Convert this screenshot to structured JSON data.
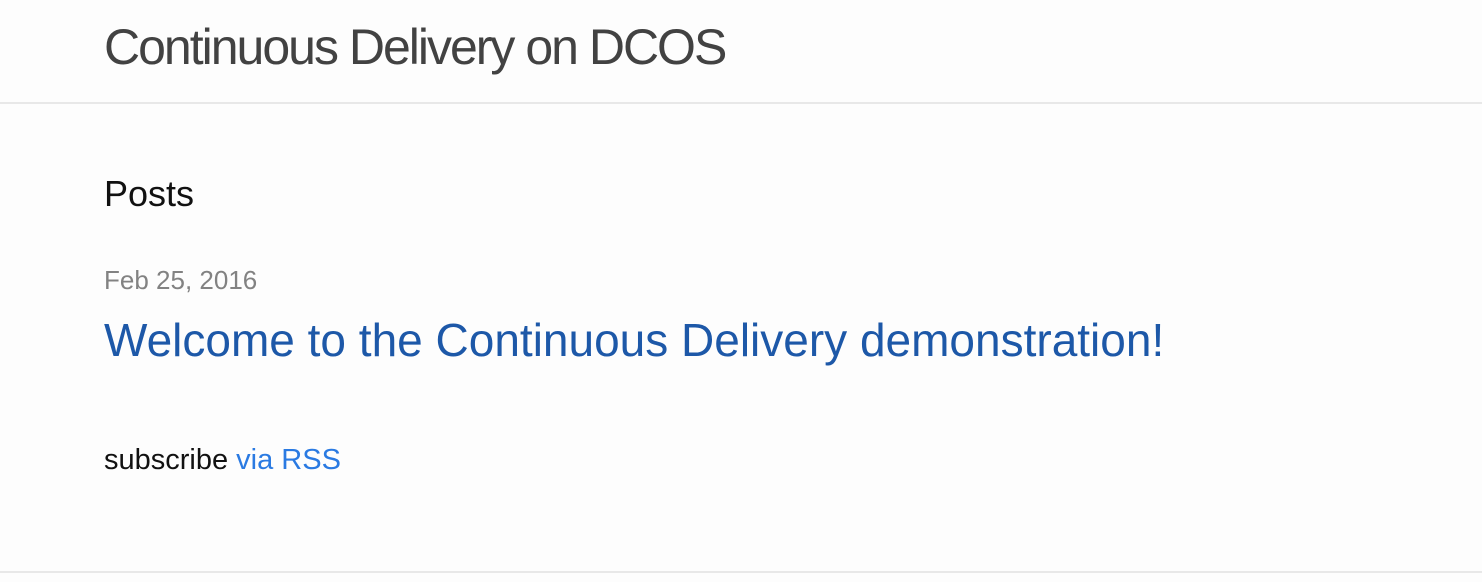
{
  "header": {
    "site_title": "Continuous Delivery on DCOS"
  },
  "main": {
    "heading": "Posts",
    "posts": [
      {
        "date": "Feb 25, 2016",
        "title": "Welcome to the Continuous Delivery demonstration!"
      }
    ],
    "rss": {
      "prefix": "subscribe ",
      "link_label": "via RSS"
    }
  },
  "colors": {
    "background": "#fdfdfd",
    "title_text": "#424242",
    "post_link": "#1d58a8",
    "rss_link": "#2a7ae2",
    "meta_text": "#828282",
    "divider": "#e8e8e8"
  }
}
